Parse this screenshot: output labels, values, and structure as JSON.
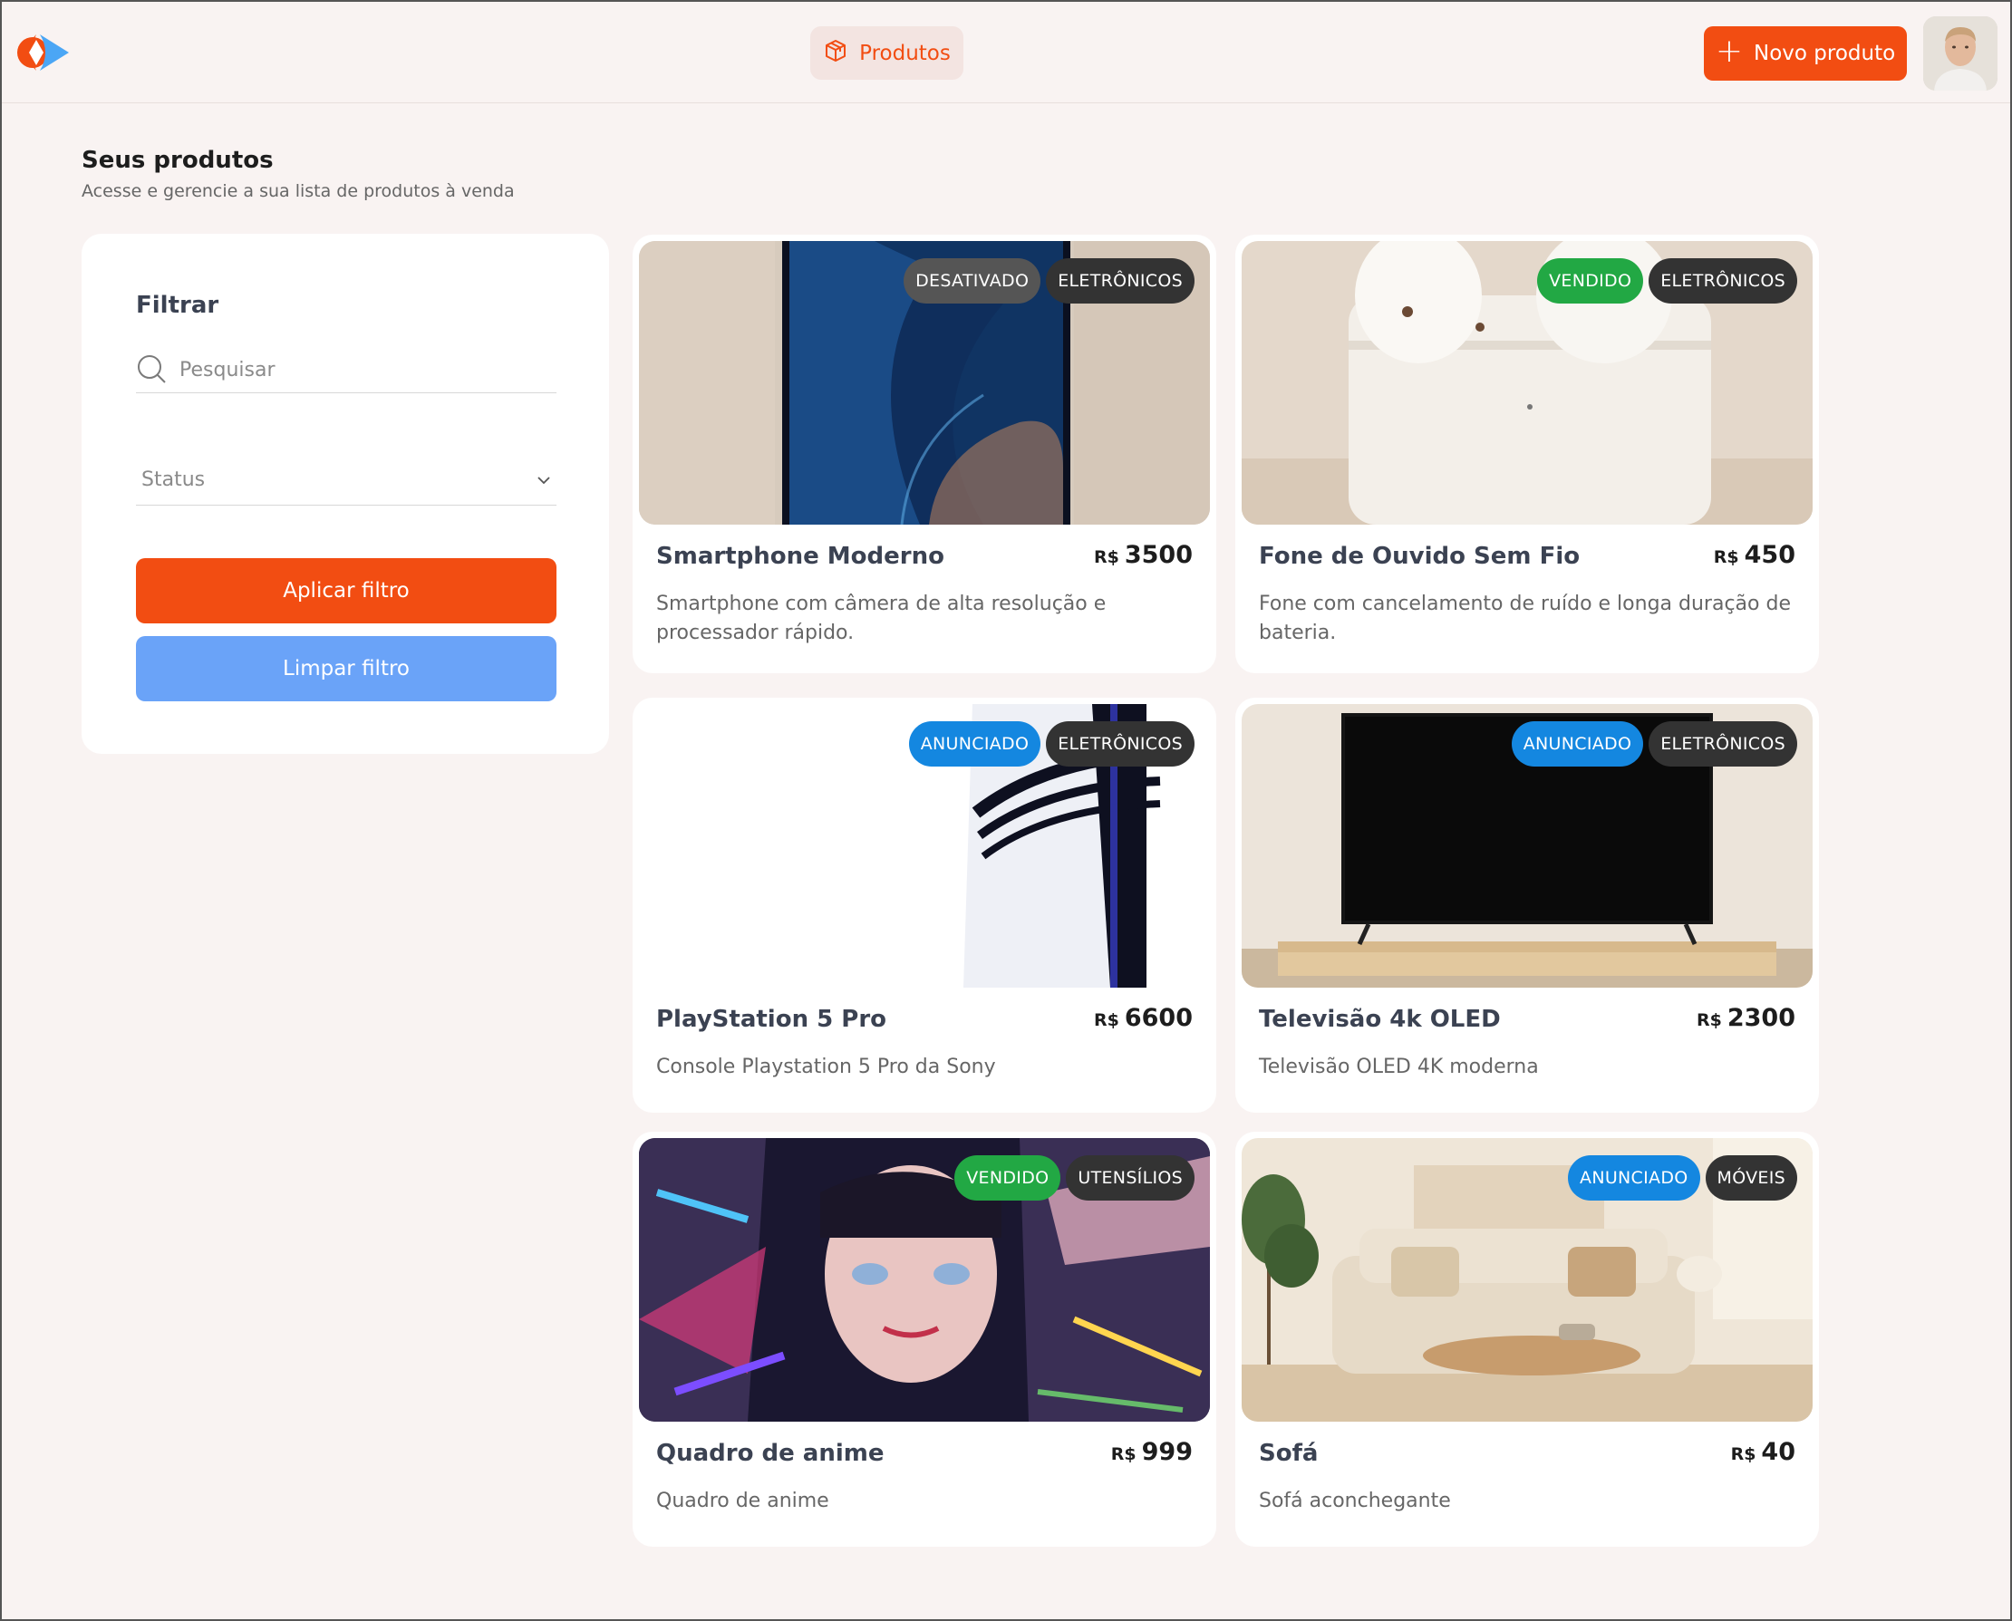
{
  "header": {
    "nav_tab_label": "Produtos",
    "new_product_label": "Novo produto"
  },
  "page": {
    "title": "Seus produtos",
    "subtitle": "Acesse e gerencie a sua lista de produtos à venda"
  },
  "filter": {
    "title": "Filtrar",
    "search_placeholder": "Pesquisar",
    "search_value": "",
    "status_placeholder": "Status",
    "apply_label": "Aplicar filtro",
    "clear_label": "Limpar filtro"
  },
  "colors": {
    "accent": "#f24d12",
    "clear_button": "#6aa3f8",
    "status_desativado": "#555555",
    "status_vendido": "#22a844",
    "status_anunciado": "#1487e0",
    "category_badge": "#333333"
  },
  "products": [
    {
      "name": "Smartphone Moderno",
      "currency": "R$",
      "price": "3500",
      "description": "Smartphone com câmera de alta resolução e processador rápido.",
      "status": "DESATIVADO",
      "category": "ELETRÔNICOS",
      "image": "smartphone-image"
    },
    {
      "name": "Fone de Ouvido Sem Fio",
      "currency": "R$",
      "price": "450",
      "description": "Fone com cancelamento de ruído e longa duração de bateria.",
      "status": "VENDIDO",
      "category": "ELETRÔNICOS",
      "image": "earbuds-image"
    },
    {
      "name": "PlayStation 5 Pro",
      "currency": "R$",
      "price": "6600",
      "description": "Console Playstation 5 Pro da Sony",
      "status": "ANUNCIADO",
      "category": "ELETRÔNICOS",
      "image": "console-image"
    },
    {
      "name": "Televisão 4k OLED",
      "currency": "R$",
      "price": "2300",
      "description": "Televisão OLED 4K moderna",
      "status": "ANUNCIADO",
      "category": "ELETRÔNICOS",
      "image": "tv-image"
    },
    {
      "name": "Quadro de anime",
      "currency": "R$",
      "price": "999",
      "description": "Quadro de anime",
      "status": "VENDIDO",
      "category": "UTENSÍLIOS",
      "image": "anime-painting-image"
    },
    {
      "name": "Sofá",
      "currency": "R$",
      "price": "40",
      "description": "Sofá aconchegante",
      "status": "ANUNCIADO",
      "category": "MÓVEIS",
      "image": "sofa-image"
    }
  ]
}
